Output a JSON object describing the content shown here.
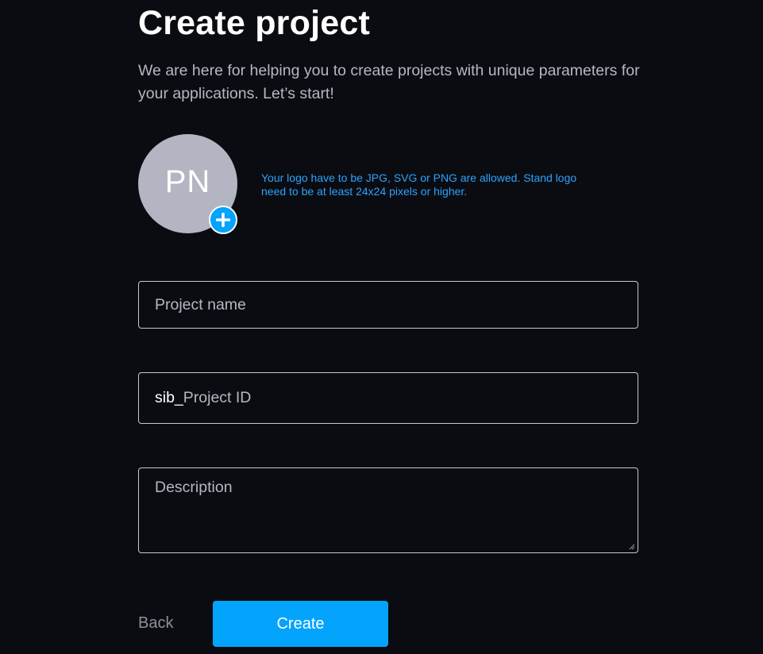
{
  "header": {
    "title": "Create project",
    "subtitle": "We are here for helping you to create projects with unique parameters for your applications. Let’s start!"
  },
  "logo": {
    "initials": "PN",
    "hint": "Your logo have to be JPG, SVG or PNG are allowed. Stand logo need to be at least 24x24 pixels or higher.",
    "add_icon": "plus-circle-icon",
    "avatar_color": "#b3b6c2",
    "add_icon_color": "#04a3fc"
  },
  "form": {
    "project_name": {
      "value": "",
      "placeholder": "Project name"
    },
    "project_id": {
      "prefix": "sib_",
      "value": "",
      "placeholder": "Project ID"
    },
    "description": {
      "value": "",
      "placeholder": "Description"
    }
  },
  "actions": {
    "back_label": "Back",
    "create_label": "Create",
    "primary_color": "#04a3fc"
  }
}
